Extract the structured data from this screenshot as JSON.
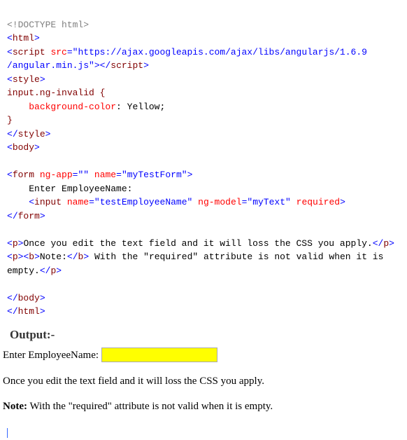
{
  "code": {
    "doctype": "<!DOCTYPE html>",
    "html_open_lt": "<",
    "html_open_tag": "html",
    "gt": ">",
    "script_open_lt": "<",
    "script_tag": "script",
    "space": " ",
    "src_attr": "src",
    "eq": "=",
    "q": "\"",
    "src_val_line1": "https://ajax.googleapis.com/ajax/libs/angularjs/1.6.9",
    "src_val_line2": "/angular.min.js",
    "script_close": "script",
    "style_tag": "style",
    "css_selector": "input.ng-invalid {",
    "css_prop_indent": "    ",
    "css_prop": "background-color",
    "css_colon": ": ",
    "css_val": "Yellow",
    "css_semi": ";",
    "css_close": "}",
    "body_tag": "body",
    "form_tag": "form",
    "ngapp_attr": "ng-app",
    "ngapp_val": "",
    "name_attr": "name",
    "form_name_val": "myTestForm",
    "form_text_indent": "    ",
    "form_text": "Enter EmployeeName:",
    "input_tag": "input",
    "input_name_val": "testEmployeeName",
    "ngmodel_attr": "ng-model",
    "ngmodel_val": "myText",
    "required_attr": "required",
    "p_tag": "p",
    "para1_text": "Once you edit the text field and it will loss the CSS you apply.",
    "b_tag": "b",
    "note_bold": "Note:",
    "para2_rest": " With the \"required\" attribute is not valid when it is ",
    "para2_wrap": "empty.",
    "slash": "/",
    "lt": "<",
    "gt2": ">",
    "gt_close": ">"
  },
  "output": {
    "heading": "Output:-",
    "label": "Enter EmployeeName:",
    "input_value": "",
    "para1": "Once you edit the text field and it will loss the CSS you apply.",
    "note_label": "Note:",
    "para2_rest": " With the \"required\" attribute is not valid when it is empty."
  }
}
